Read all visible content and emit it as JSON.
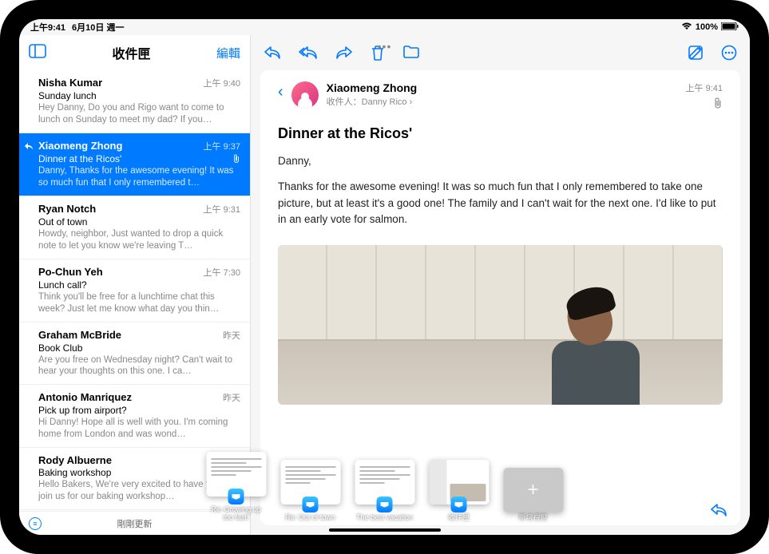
{
  "status": {
    "time": "上午9:41",
    "date": "6月10日 週一",
    "battery": "100%",
    "wifi_icon": "wifi",
    "battery_icon": "battery-full"
  },
  "sidebar": {
    "title": "收件匣",
    "edit": "編輯",
    "footer_status": "剛剛更新",
    "messages": [
      {
        "sender": "Nisha Kumar",
        "time": "上午 9:40",
        "subject": "Sunday lunch",
        "preview": "Hey Danny, Do you and Rigo want to come to lunch on Sunday to meet my dad? If you…"
      },
      {
        "sender": "Xiaomeng Zhong",
        "time": "上午 9:37",
        "subject": "Dinner at the Ricos'",
        "preview": "Danny, Thanks for the awesome evening! It was so much fun that I only remembered t…",
        "selected": true,
        "replied": true,
        "attachment": true
      },
      {
        "sender": "Ryan Notch",
        "time": "上午 9:31",
        "subject": "Out of town",
        "preview": "Howdy, neighbor, Just wanted to drop a quick note to let you know we're leaving T…"
      },
      {
        "sender": "Po-Chun Yeh",
        "time": "上午 7:30",
        "subject": "Lunch call?",
        "preview": "Think you'll be free for a lunchtime chat this week? Just let me know what day you thin…"
      },
      {
        "sender": "Graham McBride",
        "time": "昨天",
        "subject": "Book Club",
        "preview": "Are you free on Wednesday night? Can't wait to hear your thoughts on this one. I ca…"
      },
      {
        "sender": "Antonio Manriquez",
        "time": "昨天",
        "subject": "Pick up from airport?",
        "preview": "Hi Danny! Hope all is well with you. I'm coming home from London and was wond…"
      },
      {
        "sender": "Rody Albuerne",
        "time": "",
        "subject": "Baking workshop",
        "preview": "Hello Bakers, We're very excited to have you all join us for our baking workshop…"
      }
    ]
  },
  "mail": {
    "sender": "Xiaomeng Zhong",
    "to_label": "收件人：",
    "to_name": "Danny Rico",
    "time": "上午 9:41",
    "subject": "Dinner at the Ricos'",
    "greeting": "Danny,",
    "body": "Thanks for the awesome evening! It was so much fun that I only remembered to take one picture, but at least it's a good one! The family and I can't wait for the next one. I'd like to put in an early vote for salmon."
  },
  "switcher": [
    {
      "label": "Re: Growing up too fast!"
    },
    {
      "label": "Re: Out of town"
    },
    {
      "label": "The best vacation"
    },
    {
      "label": "收件匣",
      "split": true
    },
    {
      "label": "新增視窗",
      "add": true
    }
  ]
}
